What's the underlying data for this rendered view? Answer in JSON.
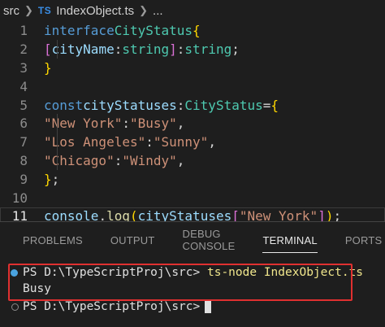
{
  "breadcrumb": {
    "folder": "src",
    "ts_badge": "TS",
    "file": "IndexObject.ts",
    "ellipsis": "..."
  },
  "editor": {
    "line_numbers": [
      "1",
      "2",
      "3",
      "4",
      "5",
      "6",
      "7",
      "8",
      "9",
      "10",
      "11"
    ],
    "active_line": "11",
    "code": {
      "l1": {
        "kw": "interface",
        "name": "CityStatus",
        "brace": "{"
      },
      "l2": {
        "open": "[",
        "key": "cityName",
        "colon": ":",
        "t1": "string",
        "close": "]",
        "colon2": ":",
        "t2": "string",
        "semi": ";"
      },
      "l3": {
        "brace": "}"
      },
      "l5": {
        "kw": "const",
        "var": "cityStatuses",
        "colon": ":",
        "type": "CityStatus",
        "eq": "=",
        "brace": "{"
      },
      "l6": {
        "k": "\"New York\"",
        "colon": ":",
        "v": "\"Busy\"",
        "comma": ","
      },
      "l7": {
        "k": "\"Los Angeles\"",
        "colon": ":",
        "v": "\"Sunny\"",
        "comma": ","
      },
      "l8": {
        "k": "\"Chicago\"",
        "colon": ":",
        "v": "\"Windy\"",
        "comma": ","
      },
      "l9": {
        "brace": "}",
        "semi": ";"
      },
      "l11": {
        "obj": "console",
        "dot": ".",
        "fn": "log",
        "p1": "(",
        "var": "cityStatuses",
        "b1": "[",
        "str": "\"New York\"",
        "b2": "]",
        "p2": ")",
        "semi": ";"
      }
    }
  },
  "panel": {
    "tabs": [
      "PROBLEMS",
      "OUTPUT",
      "DEBUG CONSOLE",
      "TERMINAL",
      "PORTS"
    ],
    "active_tab": "TERMINAL",
    "terminal": {
      "prompt1": "PS D:\\TypeScriptProj\\src>",
      "command": "ts-node IndexObject.ts",
      "output": "Busy",
      "prompt2": "PS D:\\TypeScriptProj\\src>"
    }
  },
  "colors": {
    "background": "#1e1e1e",
    "keyword": "#569cd6",
    "type": "#4ec9b0",
    "variable": "#9cdcfe",
    "string": "#ce9178",
    "function": "#dcdcaa",
    "highlight_box": "#e03030"
  },
  "icons": {
    "chevron": "chevron-right-icon",
    "status_dot": "terminal-status-dot-icon"
  }
}
